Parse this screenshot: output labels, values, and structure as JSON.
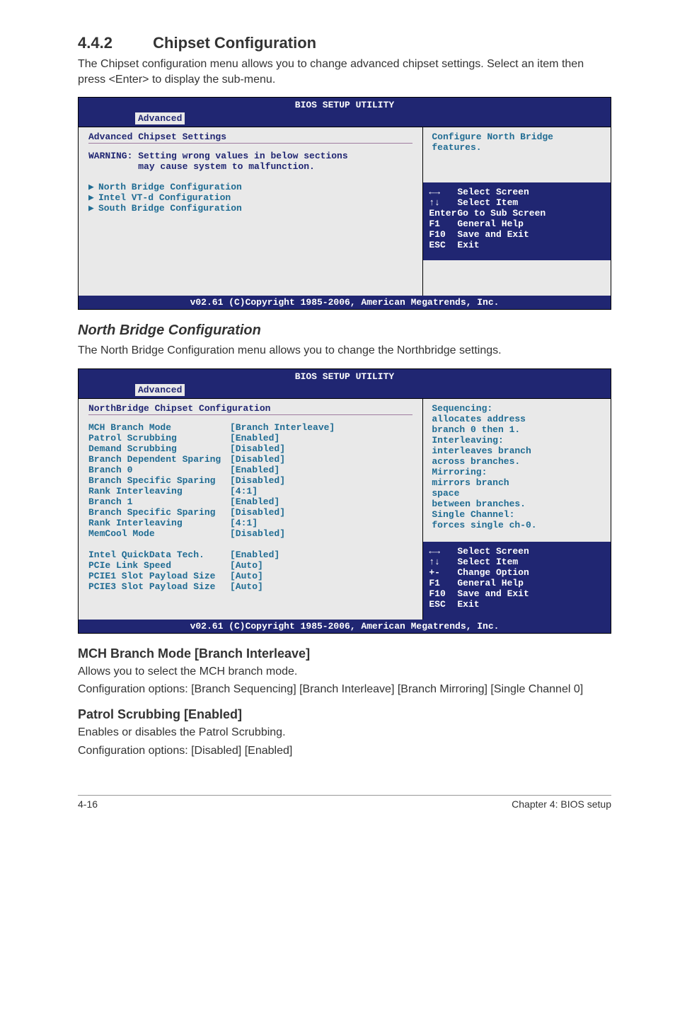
{
  "section1": {
    "number": "4.4.2",
    "title": "Chipset Configuration"
  },
  "intro1": "The Chipset configuration menu allows you to change advanced chipset settings. Select an item then press <Enter> to display the sub-menu.",
  "bios1": {
    "title": "BIOS SETUP UTILITY",
    "tab": "Advanced",
    "heading": "Advanced Chipset Settings",
    "warning": "WARNING: Setting wrong values in below sections\n         may cause system to malfunction.",
    "items": [
      "North Bridge Configuration",
      "Intel VT-d Configuration",
      "South Bridge Configuration"
    ],
    "help": "Configure North Bridge features.",
    "keys": [
      {
        "k": "←→",
        "d": "Select Screen"
      },
      {
        "k": "↑↓",
        "d": "Select Item"
      },
      {
        "k": "Enter",
        "d": "Go to Sub Screen"
      },
      {
        "k": "F1",
        "d": "General Help"
      },
      {
        "k": "F10",
        "d": "Save and Exit"
      },
      {
        "k": "ESC",
        "d": "Exit"
      }
    ],
    "footer": "v02.61 (C)Copyright 1985-2006, American Megatrends, Inc."
  },
  "section2": {
    "title": "North Bridge Configuration"
  },
  "intro2": "The North Bridge Configuration menu allows you to change the Northbridge settings.",
  "bios2": {
    "title": "BIOS SETUP UTILITY",
    "tab": "Advanced",
    "heading": "NorthBridge Chipset Configuration",
    "rows": [
      {
        "label": "MCH Branch Mode",
        "value": "[Branch Interleave]"
      },
      {
        "label": "Patrol Scrubbing",
        "value": "[Enabled]"
      },
      {
        "label": "Demand Scrubbing",
        "value": "[Disabled]"
      },
      {
        "label": "Branch Dependent Sparing",
        "value": "[Disabled]"
      },
      {
        "label": "Branch 0",
        "value": "[Enabled]"
      },
      {
        "label": "Branch Specific Sparing",
        "value": "[Disabled]"
      },
      {
        "label": "Rank Interleaving",
        "value": "[4:1]"
      },
      {
        "label": "Branch 1",
        "value": "[Enabled]"
      },
      {
        "label": "Branch Specific Sparing",
        "value": "[Disabled]"
      },
      {
        "label": "Rank Interleaving",
        "value": "[4:1]"
      },
      {
        "label": "MemCool Mode",
        "value": "[Disabled]"
      },
      {
        "label": "",
        "value": ""
      },
      {
        "label": "Intel QuickData Tech.",
        "value": "[Enabled]"
      },
      {
        "label": "PCIe Link Speed",
        "value": "[Auto]"
      },
      {
        "label": "PCIE1 Slot Payload Size",
        "value": "[Auto]"
      },
      {
        "label": "PCIE3 Slot Payload Size",
        "value": "[Auto]"
      }
    ],
    "help": "Sequencing:\n  allocates address\n  branch 0 then 1.\nInterleaving:\n  interleaves branch\n  across branches.\nMirroring:\n  mirrors branch\n  space\n  between branches.\nSingle Channel:\n  forces single ch-0.",
    "keys": [
      {
        "k": "←→",
        "d": "Select Screen"
      },
      {
        "k": "↑↓",
        "d": "Select Item"
      },
      {
        "k": "+-",
        "d": "Change Option"
      },
      {
        "k": "F1",
        "d": "General Help"
      },
      {
        "k": "F10",
        "d": "Save and Exit"
      },
      {
        "k": "ESC",
        "d": "Exit"
      }
    ],
    "footer": "v02.61 (C)Copyright 1985-2006, American Megatrends, Inc."
  },
  "opt1": {
    "title": "MCH Branch Mode [Branch Interleave]",
    "l1": "Allows you to select the MCH branch mode.",
    "l2": "Configuration options: [Branch Sequencing] [Branch Interleave] [Branch Mirroring] [Single Channel 0]"
  },
  "opt2": {
    "title": "Patrol Scrubbing [Enabled]",
    "l1": "Enables or disables the Patrol Scrubbing.",
    "l2": "Configuration options: [Disabled] [Enabled]"
  },
  "pagefooter": {
    "left": "4-16",
    "right": "Chapter 4: BIOS setup"
  }
}
